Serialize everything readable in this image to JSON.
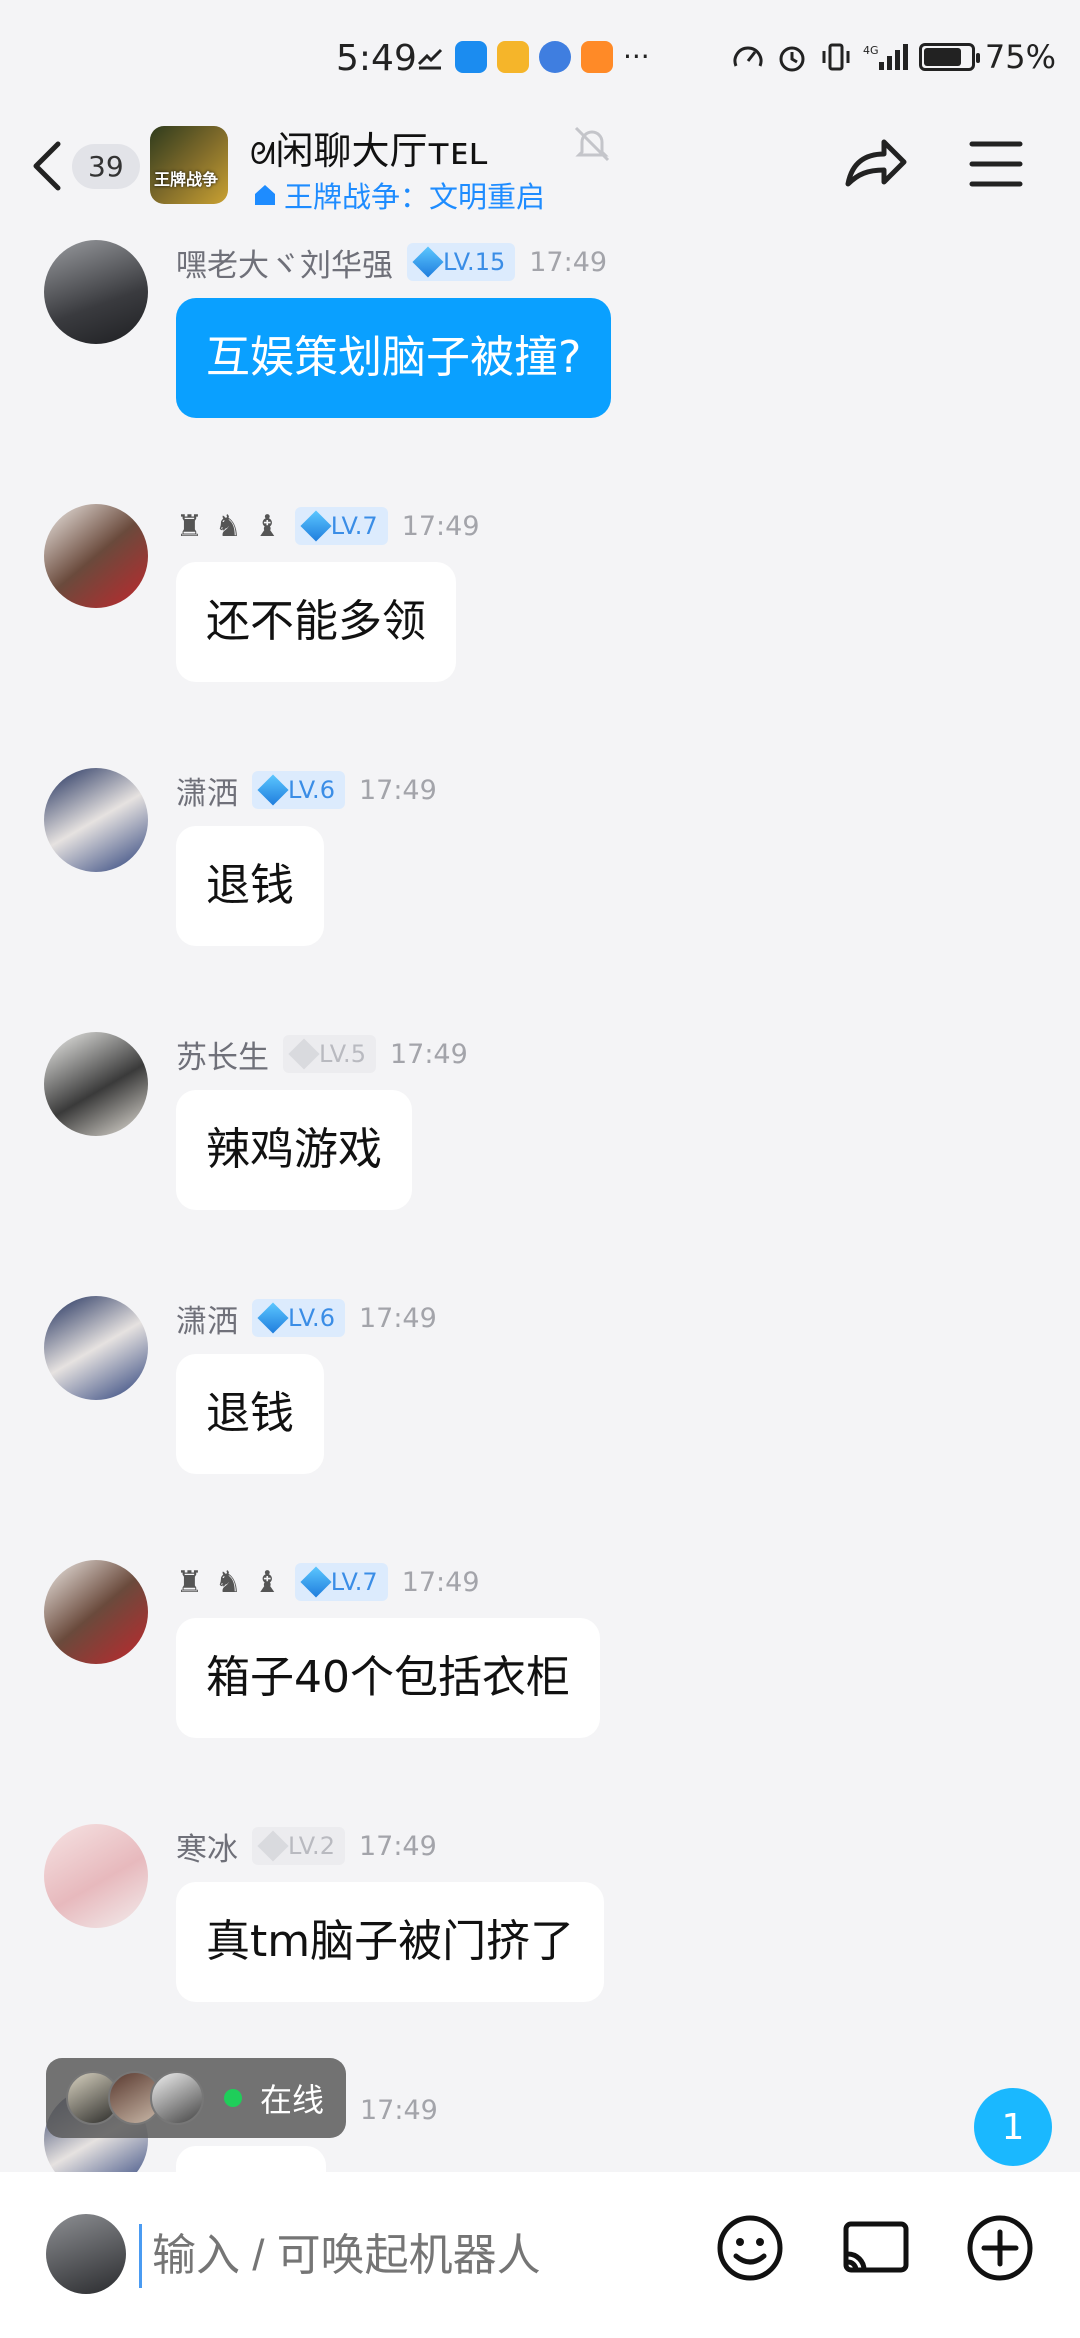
{
  "status_bar": {
    "time": "5:49",
    "battery": "75%",
    "battery_level": 0.75
  },
  "header": {
    "back_badge": "39",
    "title": "闲聊大厅",
    "title_suffix": "ᴛᴇʟ",
    "subtitle": "王牌战争：文明重启",
    "group_avatar_label": "王牌战争",
    "icons": [
      "back-icon",
      "mute-icon",
      "share-icon",
      "menu-icon"
    ]
  },
  "messages": [
    {
      "nick": "嘿老大ヾ刘华强",
      "level": "LV.15",
      "level_style": "blue",
      "time": "17:49",
      "text": "互娱策划脑子被撞?",
      "self": true
    },
    {
      "nick": "",
      "level": "LV.7",
      "level_style": "blue",
      "time": "17:49",
      "text": "还不能多领",
      "self": false
    },
    {
      "nick": "潇洒",
      "level": "LV.6",
      "level_style": "blue",
      "time": "17:49",
      "text": "退钱",
      "self": false
    },
    {
      "nick": "苏长生",
      "level": "LV.5",
      "level_style": "gray",
      "time": "17:49",
      "text": "辣鸡游戏",
      "self": false
    },
    {
      "nick": "潇洒",
      "level": "LV.6",
      "level_style": "blue",
      "time": "17:49",
      "text": "退钱",
      "self": false
    },
    {
      "nick": "",
      "level": "LV.7",
      "level_style": "blue",
      "time": "17:49",
      "text": "箱子40个包括衣柜",
      "self": false
    },
    {
      "nick": "寒冰",
      "level": "LV.2",
      "level_style": "gray",
      "time": "17:49",
      "text": "真tm脑子被门挤了",
      "self": false
    },
    {
      "nick": "",
      "level": "",
      "level_style": "blue",
      "time": "17:49",
      "text": "",
      "self": false
    }
  ],
  "online": {
    "label": "在线"
  },
  "unread_count": "1",
  "input": {
    "placeholder": "输入 / 可唤起机器人"
  },
  "colors": {
    "accent": "#0aa0ff",
    "subtitle": "#1e8cff",
    "online_dot": "#1fce5a"
  }
}
